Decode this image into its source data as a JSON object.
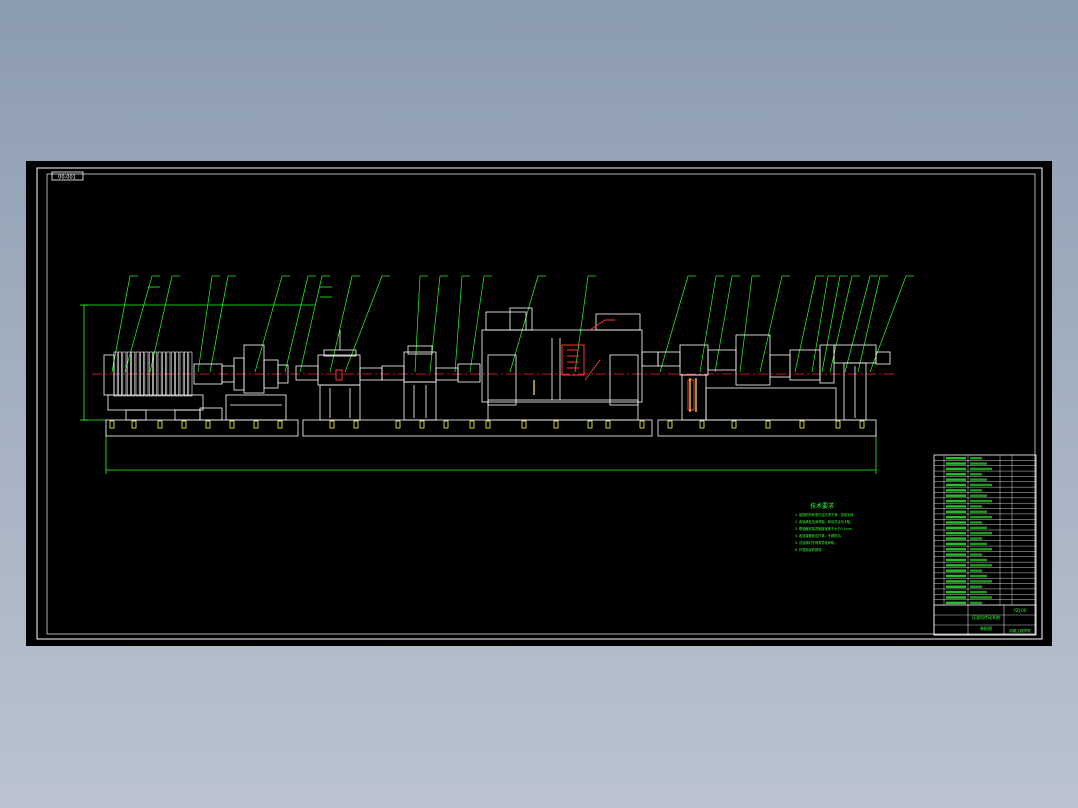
{
  "drawing": {
    "sheet_label": "00-001",
    "notes_title": "技术要求",
    "notes": [
      "1. 装配前所有零件应清洗干净，去除毛刺。",
      "2. 各轴承处加润滑脂，转动灵活无卡阻。",
      "3. 联轴器安装同轴度误差不大于0.1mm。",
      "4. 各连接螺栓应拧紧，不得松动。",
      "5. 试运转时不得有异常声响。",
      "6. 外表面涂防锈漆。"
    ],
    "title_block": {
      "title_line1": "压滤机传动系统",
      "title_line2": "装配图",
      "drawing_number": "YZJ-00",
      "school": "机械工程学院"
    },
    "part_rows": 28,
    "balloons": 36
  },
  "colors": {
    "background": "#000000",
    "frame": "#ffffff",
    "geometry": "#ffffff",
    "leaders": "#22ff22",
    "centerline": "#ff2222",
    "accent_red": "#ff3333",
    "accent_yellow": "#ffff33",
    "text_green": "#33ff33"
  }
}
